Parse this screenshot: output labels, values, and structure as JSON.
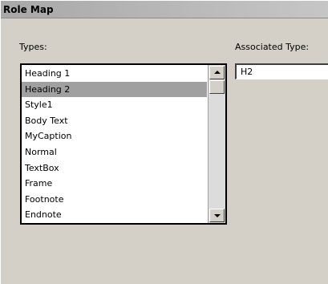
{
  "window": {
    "title": "Role Map"
  },
  "types": {
    "label": "Types:",
    "selected_index": 1,
    "items": [
      "Heading 1",
      "Heading 2",
      "Style1",
      "Body Text",
      "MyCaption",
      "Normal",
      "TextBox",
      "Frame",
      "Footnote",
      "Endnote"
    ],
    "scroll_position": 0.0
  },
  "associated_type": {
    "label": "Associated Type:",
    "value": "H2"
  },
  "icons": {
    "scroll_up": "scroll-up-arrow-icon",
    "scroll_down": "scroll-down-arrow-icon"
  },
  "colors": {
    "selection": "#a0a0a0",
    "window_bg": "#d4d0c8"
  }
}
